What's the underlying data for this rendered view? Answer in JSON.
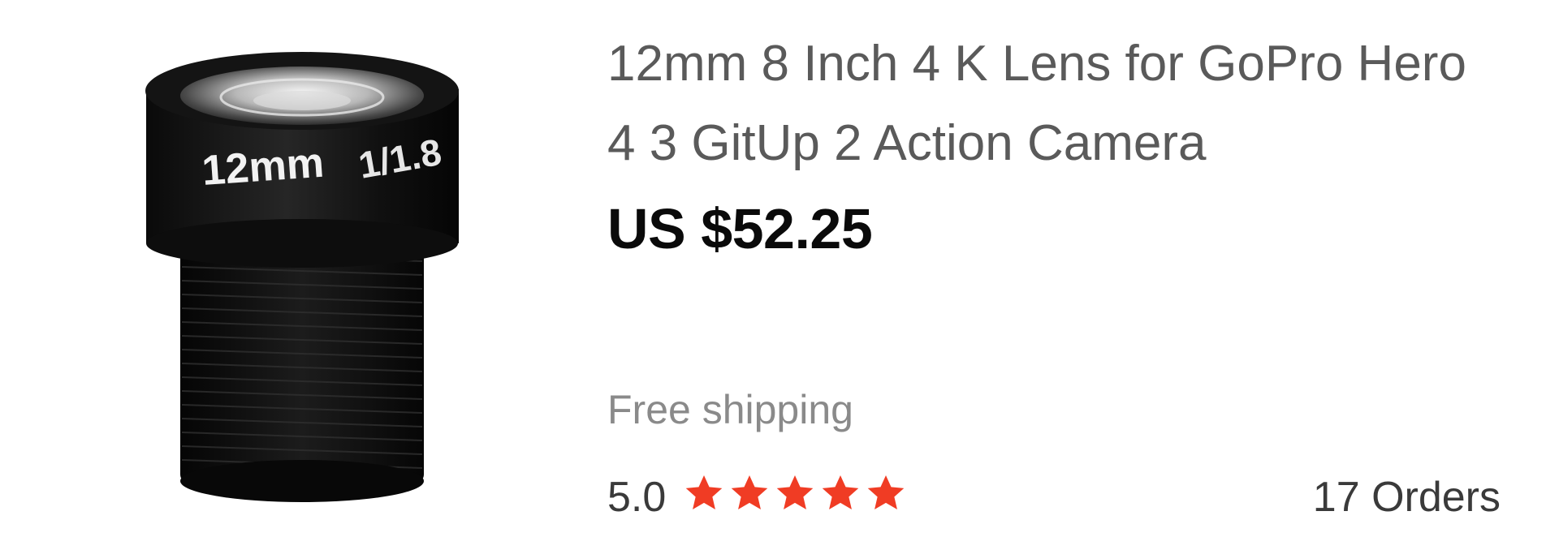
{
  "product": {
    "title": "12mm 8 Inch 4 K Lens for GoPro Hero 4 3 GitUp 2 Action Camera",
    "price": "US $52.25",
    "shipping": "Free shipping",
    "rating": {
      "value": "5.0",
      "stars_filled": 5,
      "stars_total": 5,
      "star_color": "#f03c24"
    },
    "orders": "17 Orders",
    "image": {
      "lens_text": "12mm",
      "aperture_text": "1/1.8"
    }
  }
}
